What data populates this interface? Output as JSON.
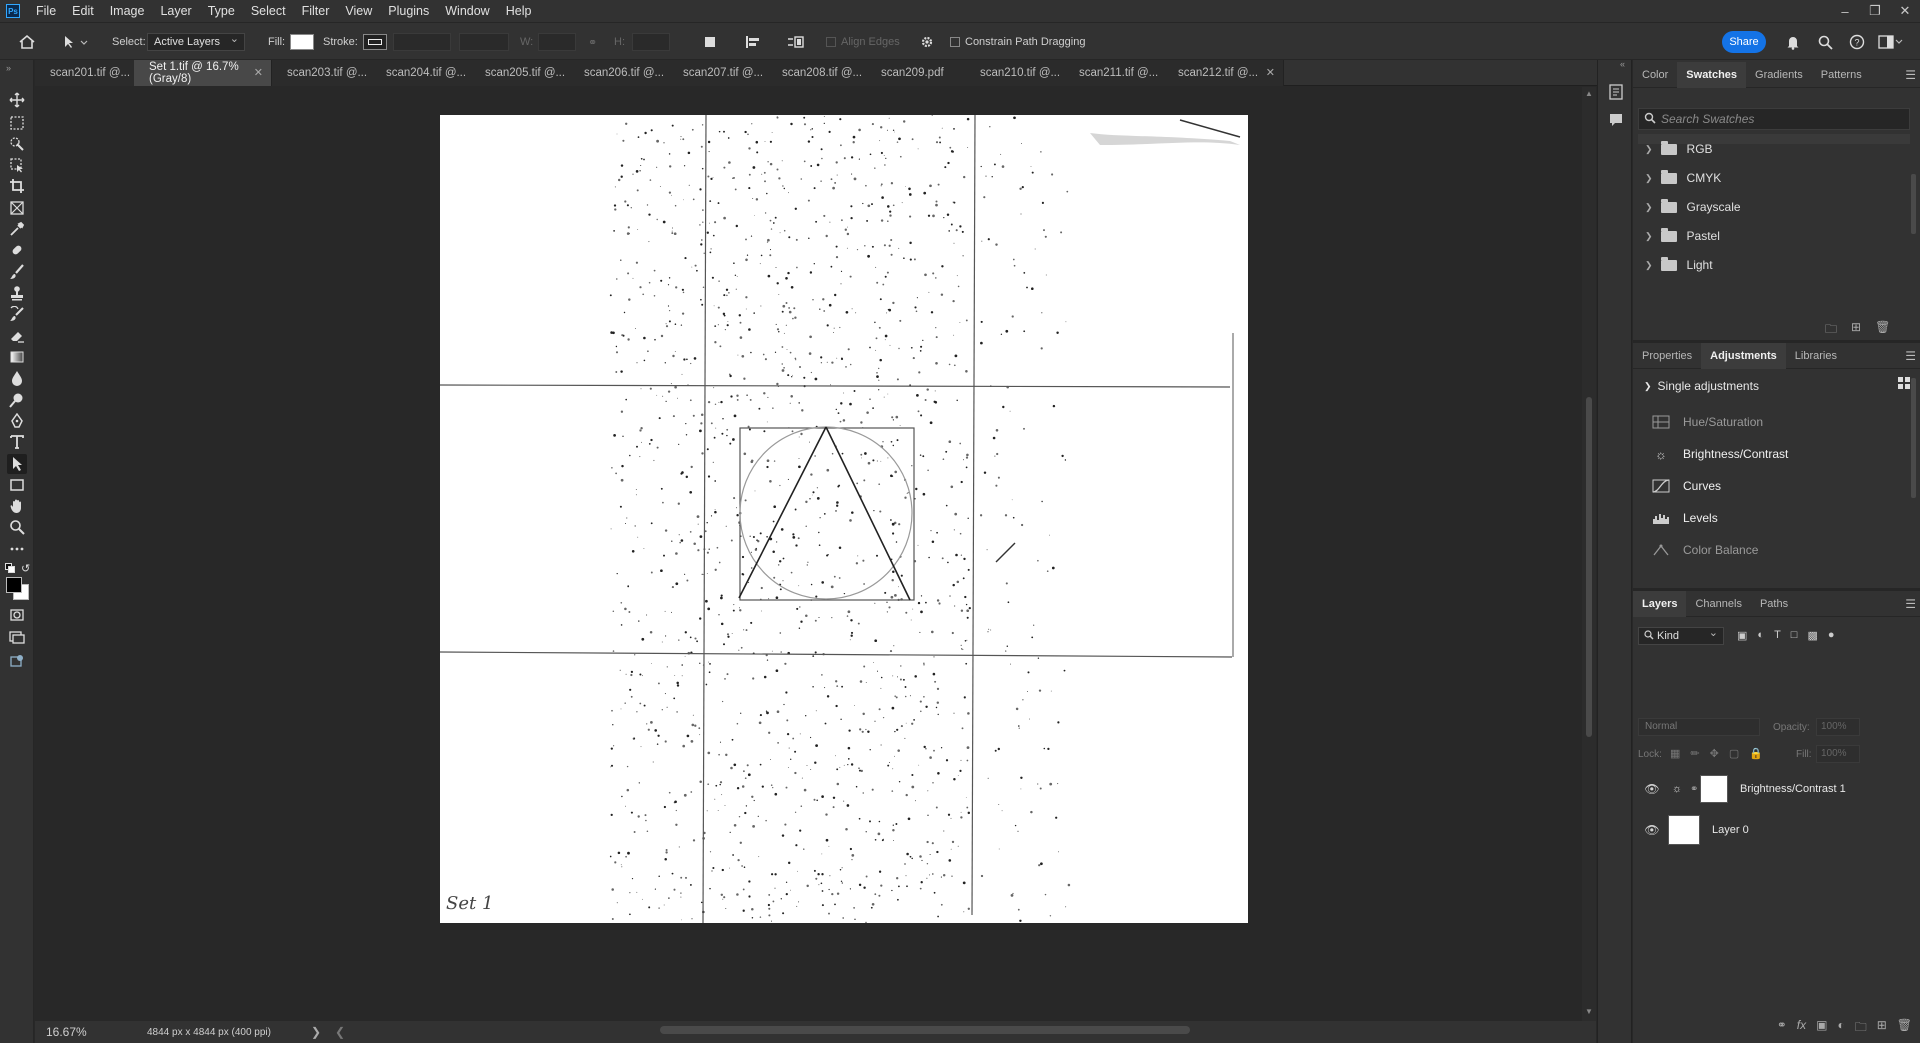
{
  "menubar": {
    "logo": "Ps",
    "items": [
      "File",
      "Edit",
      "Image",
      "Layer",
      "Type",
      "Select",
      "Filter",
      "View",
      "Plugins",
      "Window",
      "Help"
    ]
  },
  "options": {
    "select_label": "Select:",
    "select_value": "Active Layers",
    "fill_label": "Fill:",
    "stroke_label": "Stroke:",
    "w_label": "W:",
    "h_label": "H:",
    "align_edges": "Align Edges",
    "constrain": "Constrain Path Dragging",
    "share": "Share"
  },
  "tabs": [
    {
      "label": "scan201.tif @..."
    },
    {
      "label": "Set 1.tif @ 16.7% (Gray/8)"
    },
    {
      "label": "scan203.tif @..."
    },
    {
      "label": "scan204.tif @..."
    },
    {
      "label": "scan205.tif @..."
    },
    {
      "label": "scan206.tif @..."
    },
    {
      "label": "scan207.tif @..."
    },
    {
      "label": "scan208.tif @..."
    },
    {
      "label": "scan209.pdf"
    },
    {
      "label": "scan210.tif @..."
    },
    {
      "label": "scan211.tif @..."
    },
    {
      "label": "scan212.tif @..."
    }
  ],
  "document": {
    "handwriting": "Set 1"
  },
  "status": {
    "zoom": "16.67%",
    "info": "4844 px x 4844 px (400 ppi)"
  },
  "swatches_panel": {
    "tabs": [
      "Color",
      "Swatches",
      "Gradients",
      "Patterns"
    ],
    "search_placeholder": "Search Swatches",
    "groups": [
      "RGB",
      "CMYK",
      "Grayscale",
      "Pastel",
      "Light"
    ]
  },
  "adjustments_panel": {
    "tabs": [
      "Properties",
      "Adjustments",
      "Libraries"
    ],
    "section": "Single adjustments",
    "items": [
      "Hue/Saturation",
      "Brightness/Contrast",
      "Curves",
      "Levels",
      "Color Balance"
    ]
  },
  "layers_panel": {
    "tabs": [
      "Layers",
      "Channels",
      "Paths"
    ],
    "kind": "Kind",
    "blend_mode": "Normal",
    "opacity_label": "Opacity:",
    "opacity_value": "100%",
    "lock_label": "Lock:",
    "fill_label": "Fill:",
    "fill_value": "100%",
    "layers": [
      {
        "name": "Brightness/Contrast 1"
      },
      {
        "name": "Layer 0"
      }
    ]
  },
  "colors": {
    "accent": "#1473e6",
    "workspace": "#282828",
    "panel": "#323232"
  }
}
